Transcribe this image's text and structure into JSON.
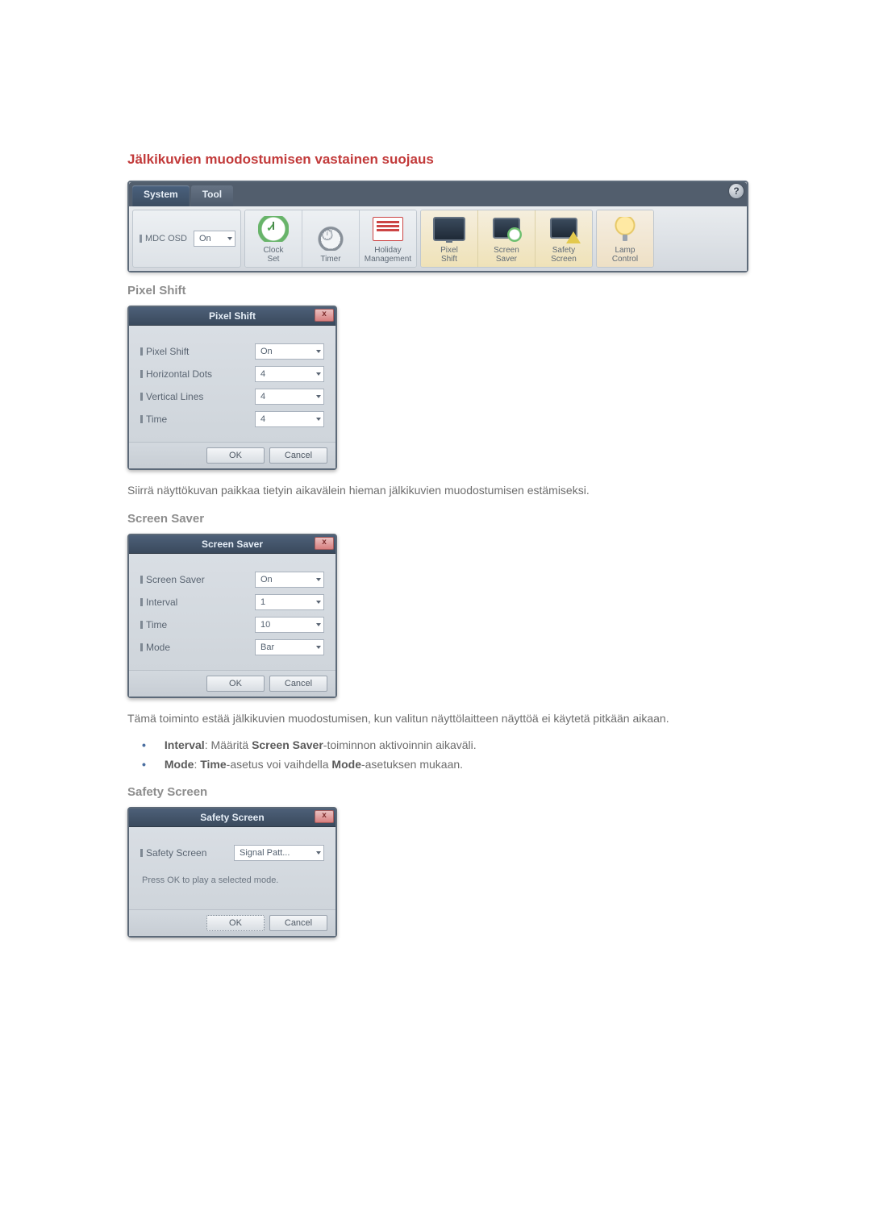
{
  "heading": "Jälkikuvien muodostumisen vastainen suojaus",
  "toolbar": {
    "tabs": {
      "system": "System",
      "tool": "Tool"
    },
    "help_badge": "?",
    "mdc": {
      "label": "MDC OSD",
      "value": "On"
    },
    "icons": [
      {
        "name": "clock-set",
        "label": "Clock\nSet"
      },
      {
        "name": "timer",
        "label": "Timer"
      },
      {
        "name": "holiday-management",
        "label": "Holiday\nManagement"
      },
      {
        "name": "pixel-shift",
        "label": "Pixel\nShift"
      },
      {
        "name": "screen-saver",
        "label": "Screen\nSaver"
      },
      {
        "name": "safety-screen",
        "label": "Safety\nScreen"
      },
      {
        "name": "lamp-control",
        "label": "Lamp\nControl"
      }
    ]
  },
  "pixel_shift": {
    "title": "Pixel Shift",
    "heading": "Pixel Shift",
    "fields": [
      {
        "label": "Pixel Shift",
        "value": "On"
      },
      {
        "label": "Horizontal Dots",
        "value": "4"
      },
      {
        "label": "Vertical Lines",
        "value": "4"
      },
      {
        "label": "Time",
        "value": "4"
      }
    ],
    "ok": "OK",
    "cancel": "Cancel",
    "descr": "Siirrä näyttökuvan paikkaa tietyin aikavälein hieman jälkikuvien muodostumisen estämiseksi."
  },
  "screen_saver": {
    "title": "Screen Saver",
    "heading": "Screen Saver",
    "fields": [
      {
        "label": "Screen Saver",
        "value": "On"
      },
      {
        "label": "Interval",
        "value": "1"
      },
      {
        "label": "Time",
        "value": "10"
      },
      {
        "label": "Mode",
        "value": "Bar"
      }
    ],
    "ok": "OK",
    "cancel": "Cancel",
    "descr": "Tämä toiminto estää jälkikuvien muodostumisen, kun valitun näyttölaitteen näyttöä ei käytetä pitkään aikaan.",
    "bullets": {
      "interval_label": "Interval",
      "interval_text": ": Määritä ",
      "interval_bold2": "Screen Saver",
      "interval_tail": "-toiminnon aktivoinnin aikaväli.",
      "mode_label": "Mode",
      "mode_text": ": ",
      "mode_bold2": "Time",
      "mode_mid": "-asetus voi vaihdella ",
      "mode_bold3": "Mode",
      "mode_tail": "-asetuksen mukaan."
    }
  },
  "safety_screen": {
    "title": "Safety Screen",
    "heading": "Safety Screen",
    "field_label": "Safety Screen",
    "field_value": "Signal Patt...",
    "msg": "Press OK to play a selected mode.",
    "ok": "OK",
    "cancel": "Cancel"
  }
}
